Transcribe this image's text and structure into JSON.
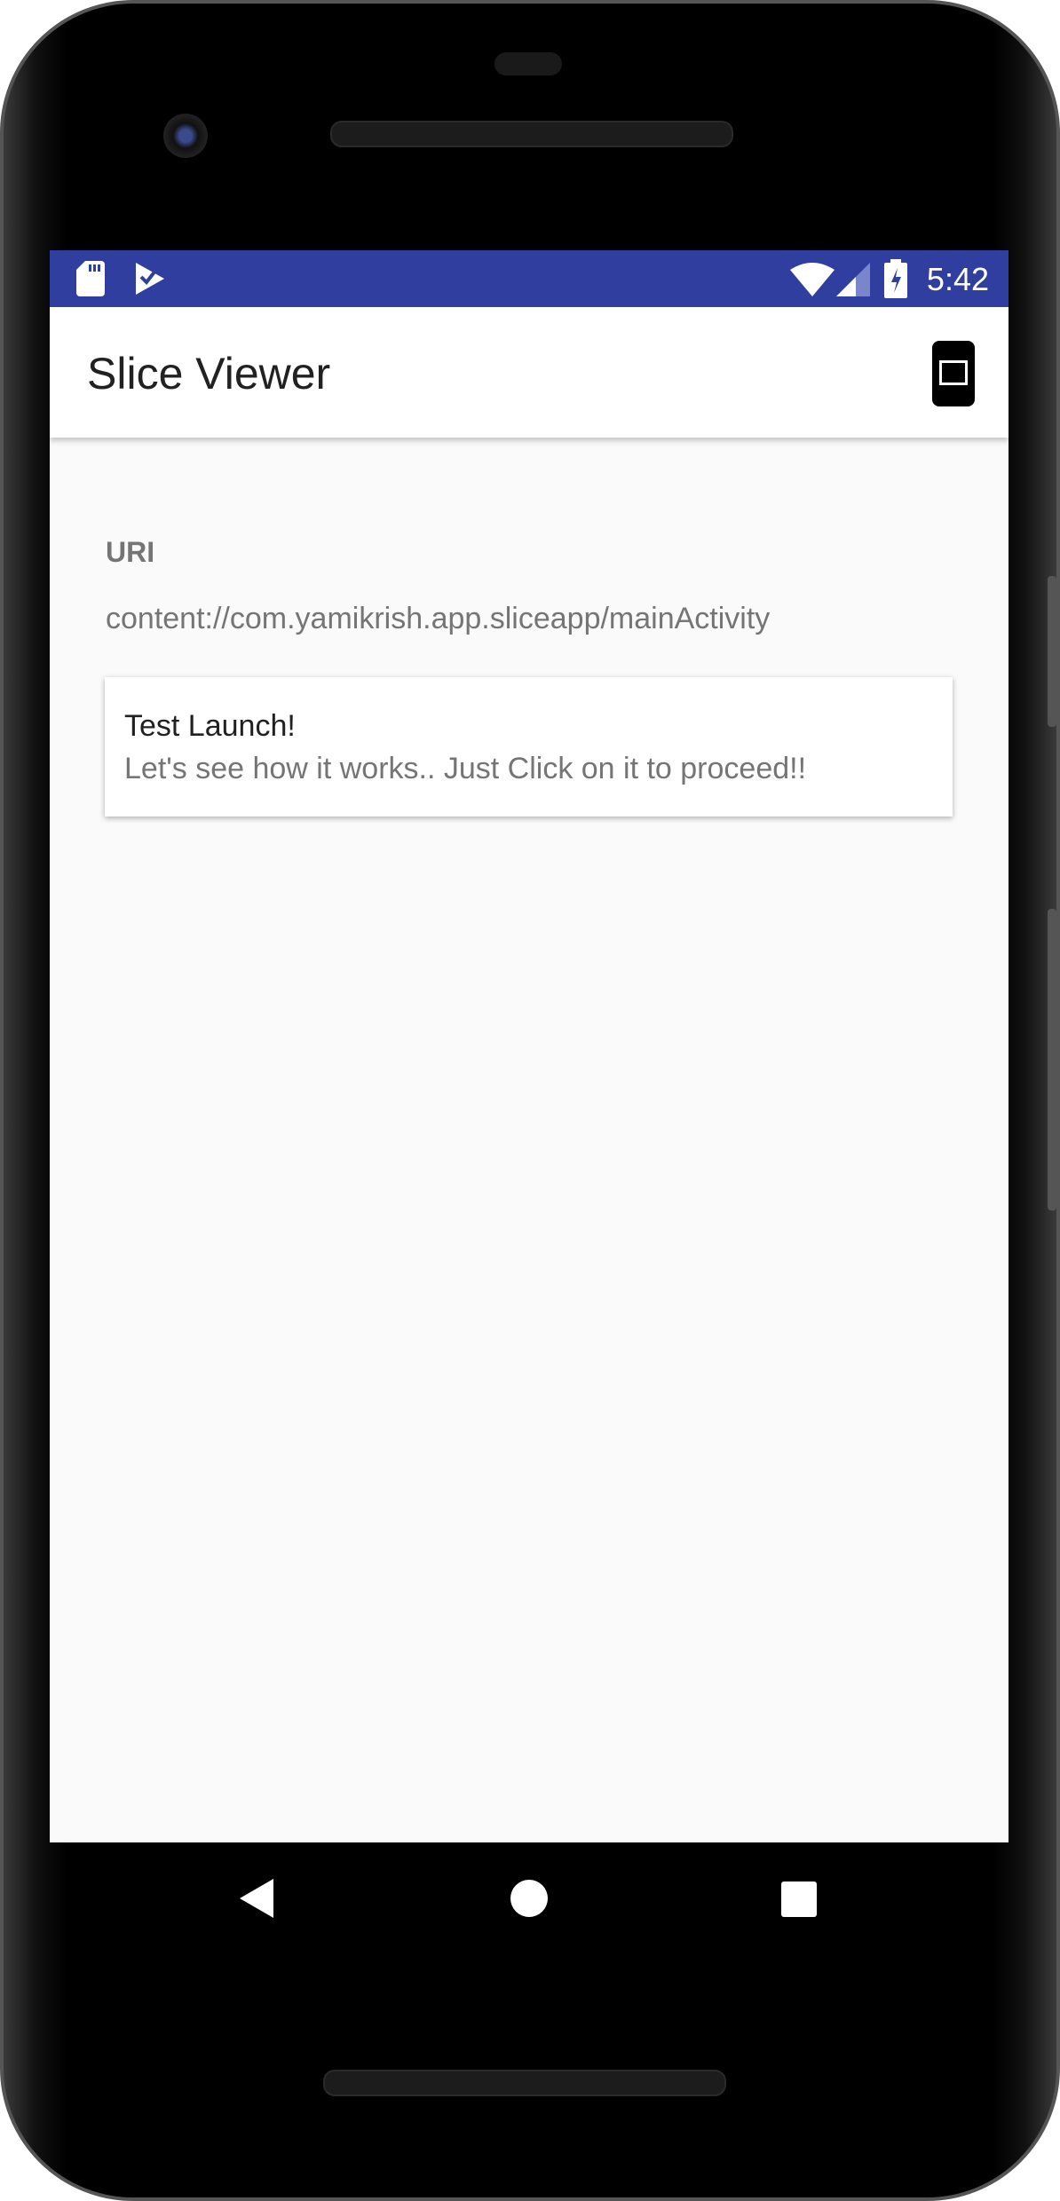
{
  "status_bar": {
    "time": "5:42",
    "icons": [
      "sd-card-icon",
      "task-icon",
      "wifi-icon",
      "signal-icon",
      "battery-charging-icon"
    ],
    "color": "#303f9f"
  },
  "toolbar": {
    "title": "Slice Viewer",
    "mode_icon": "slice-mode-icon"
  },
  "main": {
    "uri_label": "URI",
    "uri_value": "content://com.yamikrish.app.sliceapp/mainActivity",
    "slice": {
      "title": "Test Launch!",
      "subtitle": "Let's see how it works.. Just Click on it to proceed!!"
    }
  },
  "nav_bar": {
    "buttons": [
      "back",
      "home",
      "recents"
    ]
  }
}
